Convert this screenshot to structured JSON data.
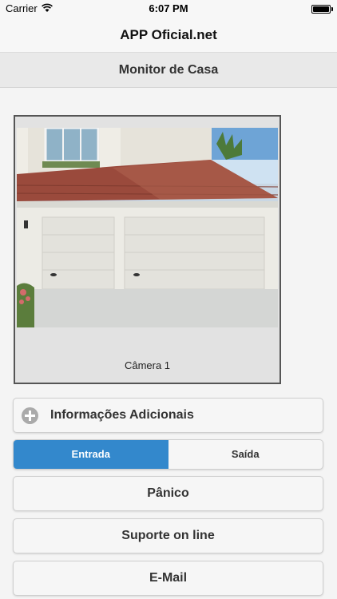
{
  "status_bar": {
    "carrier": "Carrier",
    "time": "6:07 PM"
  },
  "header": {
    "title": "APP Oficial.net"
  },
  "page": {
    "title": "Monitor de Casa"
  },
  "camera": {
    "caption": "Câmera 1"
  },
  "info": {
    "label": "Informações Adicionais"
  },
  "direction_toggle": {
    "entrada": "Entrada",
    "saida": "Saída",
    "selected": "Entrada"
  },
  "actions": {
    "panic": "Pânico",
    "support": "Suporte on line",
    "email": "E-Mail"
  },
  "colors": {
    "accent": "#3388cc"
  }
}
